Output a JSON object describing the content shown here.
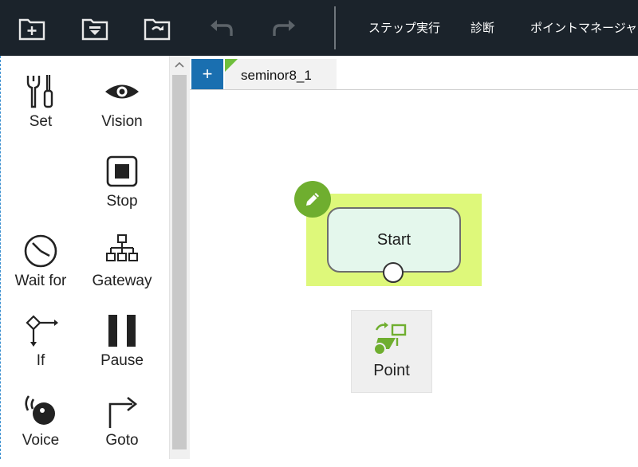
{
  "toolbar": {
    "buttons": [
      {
        "icon": "new-folder-icon"
      },
      {
        "icon": "save-folder-icon"
      },
      {
        "icon": "reload-folder-icon"
      },
      {
        "icon": "undo-icon"
      },
      {
        "icon": "redo-icon"
      }
    ],
    "step_run_label": "ステップ実行",
    "diagnose_label": "診断",
    "point_manager_label": "ポイントマネージャ"
  },
  "palette": {
    "items": [
      {
        "label": "Set",
        "icon": "tools-icon"
      },
      {
        "label": "Vision",
        "icon": "eye-icon"
      },
      {
        "label": "Stop",
        "icon": "stop-icon"
      },
      {
        "label": "Wait for",
        "icon": "clock-icon"
      },
      {
        "label": "Gateway",
        "icon": "gateway-icon"
      },
      {
        "label": "If",
        "icon": "branch-icon"
      },
      {
        "label": "Pause",
        "icon": "pause-icon"
      },
      {
        "label": "Voice",
        "icon": "voice-icon"
      },
      {
        "label": "Goto",
        "icon": "goto-arrow-icon"
      }
    ]
  },
  "editor": {
    "add_tab_label": "+",
    "tab_label": "seminor8_1",
    "nodes": {
      "start_label": "Start",
      "point_label": "Point"
    }
  },
  "colors": {
    "toolbar_bg": "#1b232b",
    "selection_bg": "#def87a",
    "start_fill": "#e4f7ec",
    "accent_green": "#6fae2f",
    "tab_add_blue": "#1a6fb0"
  }
}
